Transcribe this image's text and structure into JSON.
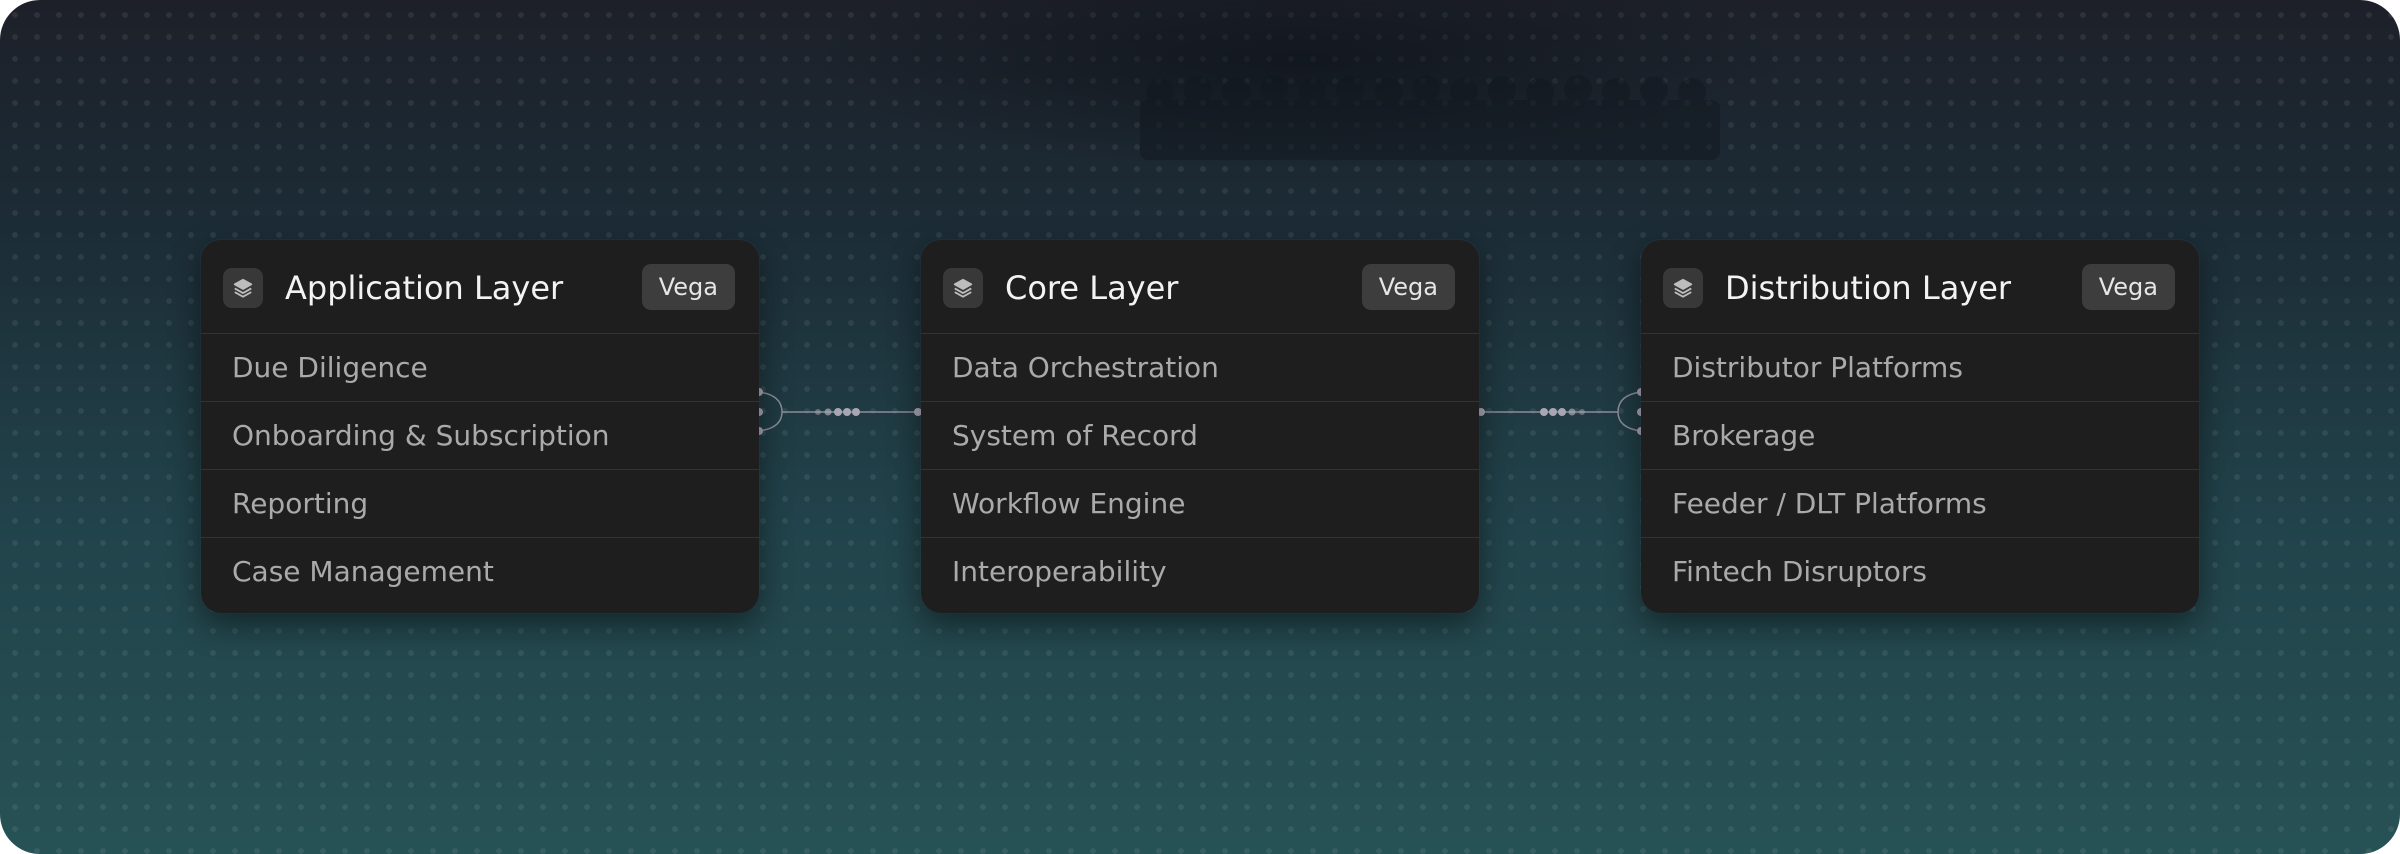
{
  "layers": [
    {
      "title": "Application Layer",
      "badge": "Vega",
      "icon": "stack-icon",
      "items": [
        "Due Diligence",
        "Onboarding & Subscription",
        "Reporting",
        "Case Management"
      ]
    },
    {
      "title": "Core Layer",
      "badge": "Vega",
      "icon": "stack-icon",
      "items": [
        "Data Orchestration",
        "System of Record",
        "Workflow Engine",
        "Interoperability"
      ]
    },
    {
      "title": "Distribution Layer",
      "badge": "Vega",
      "icon": "stack-icon",
      "items": [
        "Distributor Platforms",
        "Brokerage",
        "Feeder / DLT Platforms",
        "Fintech Disruptors"
      ]
    }
  ],
  "edges": [
    {
      "from": "Application Layer",
      "to": "Core Layer"
    },
    {
      "from": "Core Layer",
      "to": "Distribution Layer"
    }
  ],
  "colors": {
    "card_bg": "#1e1e1e",
    "badge_bg": "#3d3d3d",
    "connector": "#9a98a6"
  }
}
